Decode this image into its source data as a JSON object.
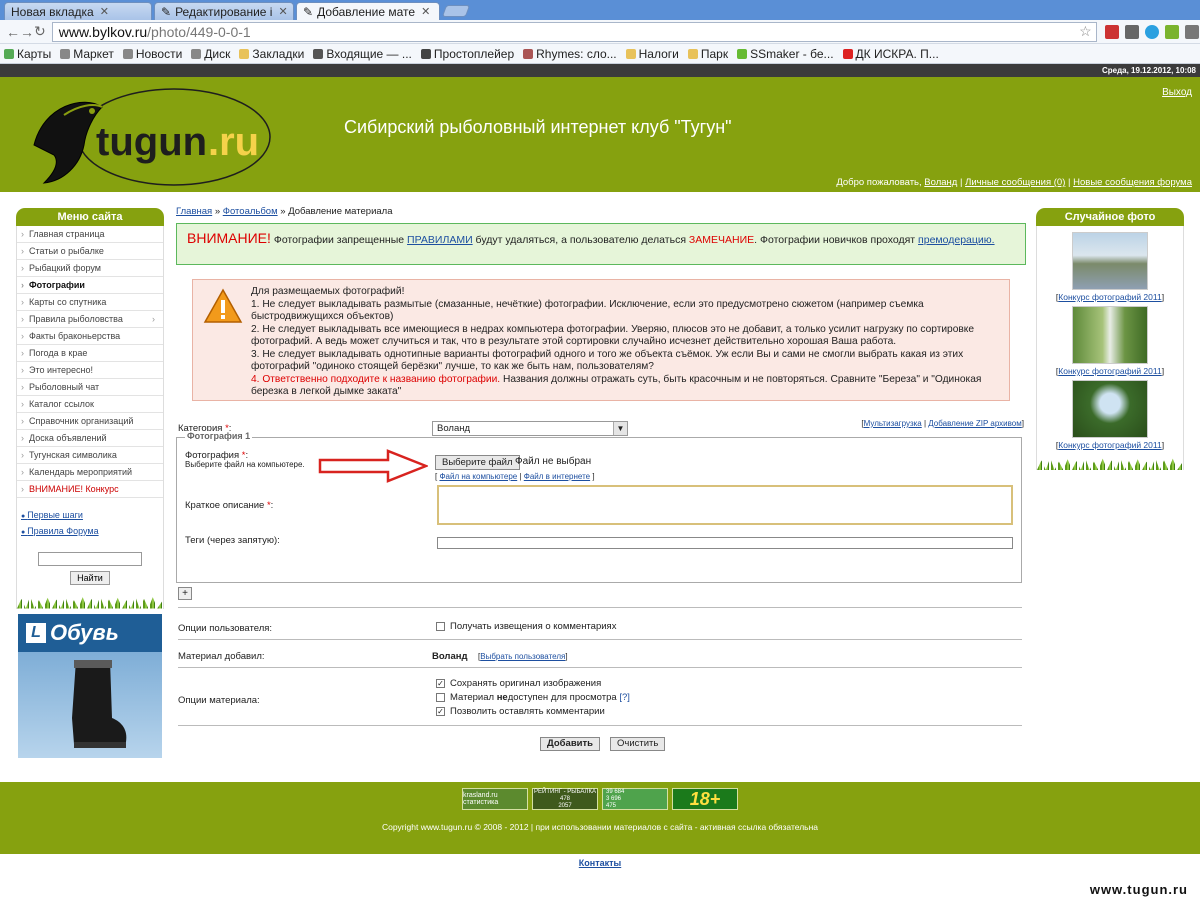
{
  "browser": {
    "tabs": [
      {
        "label": "Новая вкладка"
      },
      {
        "label": "Редактирование і"
      },
      {
        "label": "Добавление мате"
      }
    ],
    "url_host": "www.bylkov.ru",
    "url_path": "/photo/449-0-0-1",
    "bookmarks": [
      "Карты",
      "Маркет",
      "Новости",
      "Диск",
      "Закладки",
      "Входящие — ...",
      "Простоплейер",
      "Rhymes: сло...",
      "Налоги",
      "Парк",
      "SSmaker - бе...",
      "ДК ИСКРА. П..."
    ]
  },
  "datebar": "Среда, 19.12.2012, 10:08",
  "header": {
    "logo_text": "tugun.ru",
    "site_title": "Сибирский рыболовный интернет клуб \"Тугун\"",
    "logout": "Выход",
    "welcome_prefix": "Добро пожаловать,",
    "username": "Воланд",
    "sep1": "|",
    "messages": "Личные сообщения (0)",
    "sep2": "|",
    "forum_msgs": "Новые сообщения форума"
  },
  "left_menu": {
    "title": "Меню сайта",
    "items": [
      {
        "label": "Главная страница"
      },
      {
        "label": "Статьи о рыбалке"
      },
      {
        "label": "Рыбацкий форум"
      },
      {
        "label": "Фотографии"
      },
      {
        "label": "Карты со спутника"
      },
      {
        "label": "Правила рыболовства"
      },
      {
        "label": "Факты браконьерства"
      },
      {
        "label": "Погода в крае"
      },
      {
        "label": "Это интересно!"
      },
      {
        "label": "Рыболовный чат"
      },
      {
        "label": "Каталог ссылок"
      },
      {
        "label": "Справочник организаций"
      },
      {
        "label": "Доска объявлений"
      },
      {
        "label": "Тугунская символика"
      },
      {
        "label": "Календарь мероприятий"
      },
      {
        "label": "ВНИМАНИЕ! Конкурс"
      }
    ],
    "link1": "Первые шаги",
    "link2": "Правила Форума",
    "search_button": "Найти"
  },
  "ad": {
    "title": "Обувь"
  },
  "main": {
    "crumb_home": "Главная",
    "crumb_album": "Фотоальбом",
    "crumb_current": "Добавление материала",
    "crumb_sep": "»",
    "notice_warn": "ВНИМАНИЕ!",
    "notice_text1": " Фотографии запрещенные ",
    "notice_rules": "ПРАВИЛАМИ",
    "notice_text2": " будут удаляться, а пользователю делаться ",
    "notice_remark": "ЗАМЕЧАНИЕ",
    "notice_text3": ". Фотографии новичков проходят ",
    "notice_premod": "премодерацию.",
    "rules_title": "Для размещаемых фотографий!",
    "rule1": "1. Не следует выкладывать размытые (смазанные, нечёткие) фотографии. Исключение, если это предусмотрено сюжетом (например съемка быстродвижущихся объектов)",
    "rule2": "2. Не следует выкладывать все имеющиеся в недрах компьютера фотографии. Уверяю, плюсов это не добавит, а только усилит нагрузку по сортировке фотографий. А ведь может случиться и так, что в результате этой сортировки случайно исчезнет действительно хорошая Ваша работа.",
    "rule3": "3. Не следует выкладывать однотипные варианты фотографий одного и того же объекта съёмок. Уж если Вы и сами не смогли выбрать какая из этих фотографий \"одиноко стоящей берёзки\" лучше, то как же быть нам, пользователям?",
    "rule4_red": "4. Ответственно подходите к названию фотографии.",
    "rule4_rest": " Названия должны отражать суть, быть красочным и не повторяться. Сравните \"Береза\" и \"Одинокая березка в легкой дымке заката\""
  },
  "form": {
    "category_label": "Категория ",
    "category_value": "Воланд",
    "asterisk": "*",
    "colon": ":",
    "multi_upload": "Мультизагрузка",
    "zip_upload": "Добавление ZIP архивом",
    "link_sep": "|",
    "fieldset_legend": "Фотография 1",
    "photo_label": "Фотография ",
    "photo_hint": "Выберите файл на компьютере.",
    "choose_file": "Выберите файл",
    "no_file": "Файл не выбран",
    "file_local": "Файл на компьютере",
    "file_web": "Файл в интернете",
    "desc_label": "Краткое описание ",
    "tags_label": "Теги (через запятую):",
    "plus": "+",
    "user_options_label": "Опции пользователя:",
    "notify_label": "Получать извещения о комментариях",
    "added_by_label": "Материал добавил:",
    "added_by_value": "Воланд",
    "choose_user": "Выбрать пользователя",
    "material_options_label": "Опции материала:",
    "opt1": "Сохранять оригинал изображения",
    "opt2_a": "Материал ",
    "opt2_b": "не",
    "opt2_c": "доступен для просмотра ",
    "opt2_q": "[?]",
    "opt3": "Позволить оставлять комментарии",
    "submit": "Добавить",
    "reset": "Очистить"
  },
  "right": {
    "title": "Случайное фото",
    "captions": [
      "Конкурс фотографий 2011",
      "Конкурс фотографий 2011",
      "Конкурс фотографий 2011"
    ]
  },
  "footer": {
    "counter1": "krasland.ru статистика",
    "counter2a": "РЕЙТИНГ - РЫБАЛКА",
    "counter2b": "478",
    "counter2c": "2057",
    "counter3a": "39 684",
    "counter3b": "3 696",
    "counter3c": "475",
    "counter4": "18+",
    "copyright": "Copyright www.tugun.ru © 2008 - 2012 | при использовании материалов с сайта - активная ссылка обязательна",
    "contacts": "Контакты"
  },
  "watermark": "www.tugun.ru",
  "colors": {
    "header_green": "#86a10f",
    "notice_green": "#e6f5d9",
    "rules_bg": "#fbe9e4",
    "link_blue": "#1d4fa0",
    "warning_red": "#d00"
  }
}
